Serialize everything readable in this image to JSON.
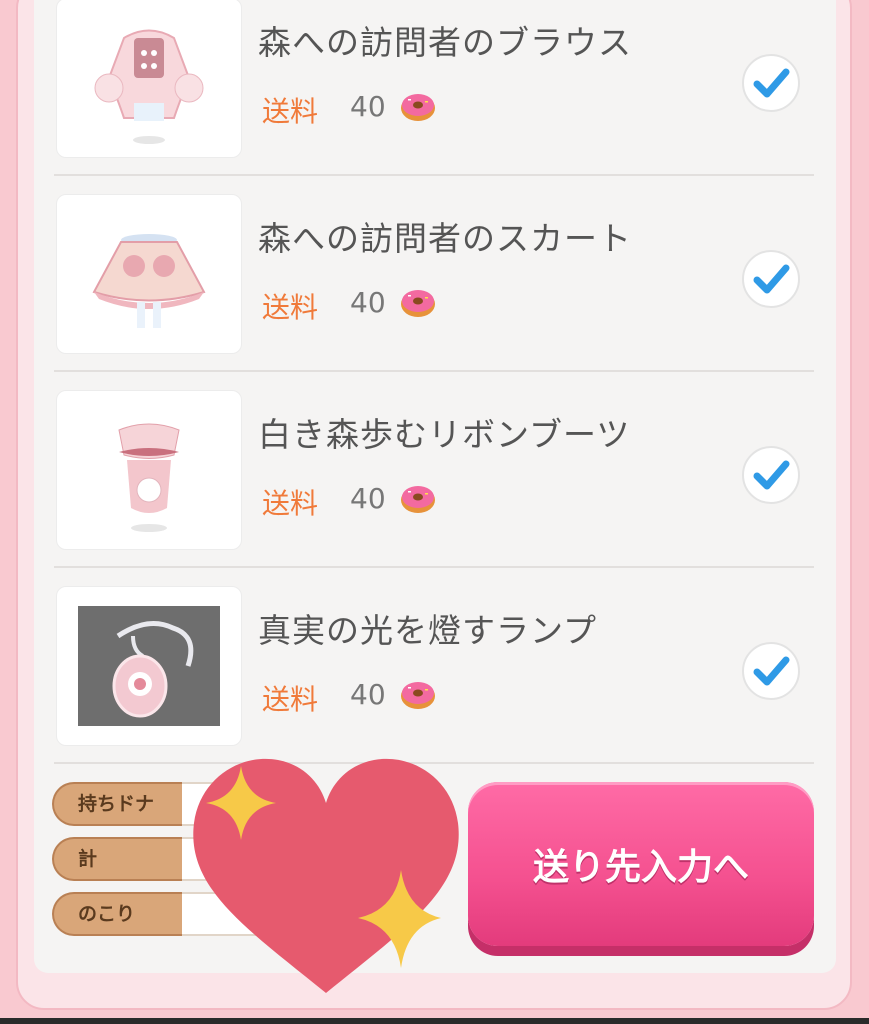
{
  "items": [
    {
      "name": "森への訪問者のブラウス",
      "fee_label": "送料",
      "fee_value": "40",
      "checked": true
    },
    {
      "name": "森への訪問者のスカート",
      "fee_label": "送料",
      "fee_value": "40",
      "checked": true
    },
    {
      "name": "白き森歩むリボンブーツ",
      "fee_label": "送料",
      "fee_value": "40",
      "checked": true
    },
    {
      "name": "真実の光を燈すランプ",
      "fee_label": "送料",
      "fee_value": "40",
      "checked": true
    }
  ],
  "balance": {
    "owned_label": "持ちドナ",
    "total_label": "計",
    "remaining_label": "のこり"
  },
  "send_button_label": "送り先入力へ",
  "colors": {
    "accent_pink": "#f4508f",
    "fee_orange": "#f07a3a",
    "check_blue": "#2f9ae6",
    "sticker_heart": "#e65a6e",
    "sticker_sparkle": "#f7c948"
  },
  "icons": [
    "donut-icon",
    "check-icon",
    "heart-sticker",
    "sparkle-icon"
  ]
}
